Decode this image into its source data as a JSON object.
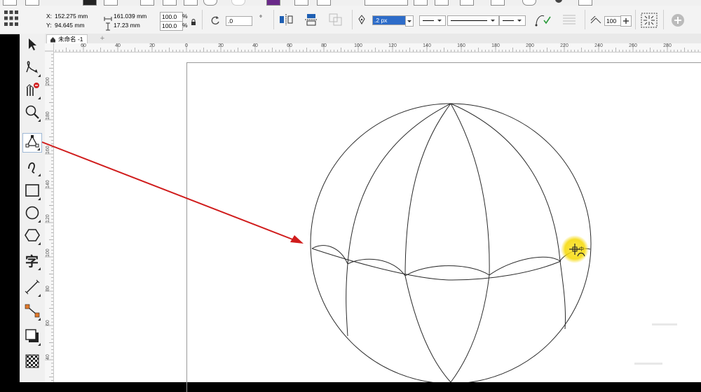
{
  "propbar": {
    "x": "152.275 mm",
    "y": "94.645 mm",
    "width": "161.039 mm",
    "height": "17.23 mm",
    "scale_x": "100.0",
    "scale_y": "100.0",
    "percent": "%",
    "rotation": ".0",
    "degree": "°",
    "outline_width": ".2 px",
    "smoothness": "100",
    "x_label": "X:",
    "y_label": "Y:"
  },
  "document": {
    "tab_title": "未命名 -1"
  },
  "rulers": {
    "horizontal": [
      "60",
      "40",
      "20",
      "0",
      "20",
      "40",
      "60",
      "80",
      "100",
      "120",
      "140",
      "160",
      "180",
      "200",
      "220",
      "240",
      "260",
      "280"
    ],
    "vertical": [
      "200",
      "180",
      "160",
      "140",
      "120",
      "100",
      "80",
      "60",
      "40"
    ]
  },
  "colors": {
    "arrow": "#d01c1c",
    "highlight": "#f5d800",
    "selection": "#4a7fd1"
  },
  "icons": [
    "shape-tool-icon",
    "pick-tool-icon",
    "freehand-icon",
    "zoom-icon",
    "bezier-icon",
    "rectangle-icon",
    "ellipse-icon",
    "polygon-icon",
    "text-icon",
    "dimension-icon",
    "connector-icon",
    "drop-shadow-icon",
    "transparency-icon"
  ]
}
